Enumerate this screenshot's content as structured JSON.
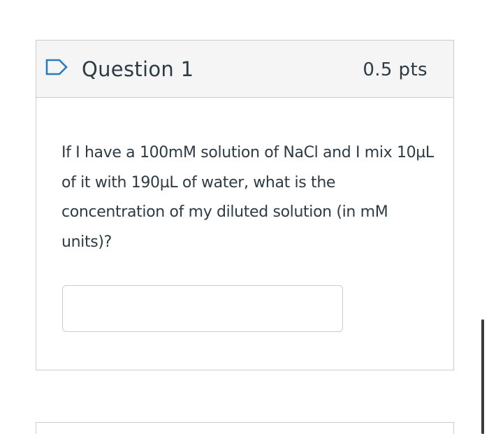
{
  "question": {
    "title": "Question 1",
    "points": "0.5 pts",
    "text": "If I have a 100mM solution of NaCl and I mix 10µL of it with 190µL of water, what is the concentration of my diluted solution (in mM units)?",
    "answer_value": "",
    "answer_placeholder": ""
  },
  "icons": {
    "flag": "flag-question-icon"
  },
  "colors": {
    "accent": "#2b7abc",
    "text": "#2d3b45",
    "border": "#c7cdd1",
    "header_bg": "#f5f5f5"
  }
}
